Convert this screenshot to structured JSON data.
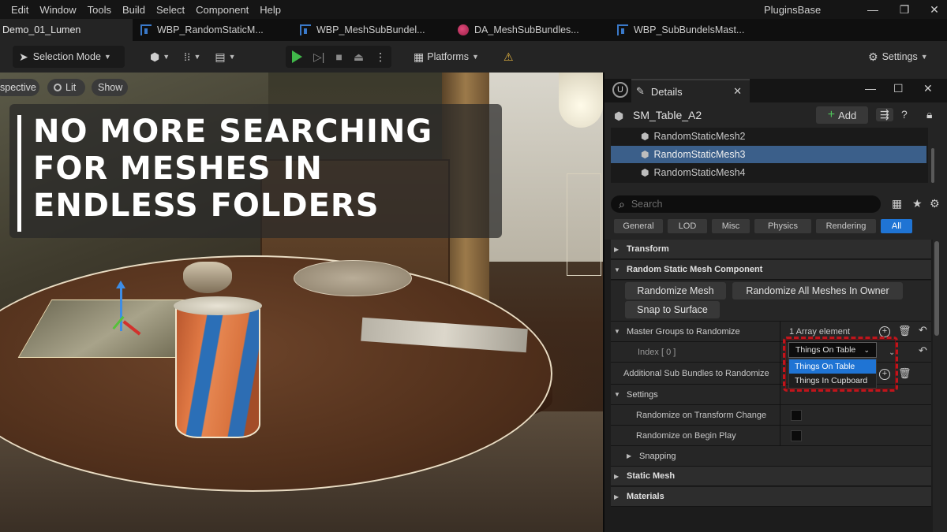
{
  "menu": [
    "Edit",
    "Window",
    "Tools",
    "Build",
    "Select",
    "Component",
    "Help"
  ],
  "project_name": "PluginsBase",
  "window_controls": {
    "minimize": "—",
    "restore": "❐",
    "close": "✕"
  },
  "tabs": [
    {
      "label": "Demo_01_Lumen",
      "icon": "level-icon"
    },
    {
      "label": "WBP_RandomStaticM...",
      "icon": "widget-blueprint-icon"
    },
    {
      "label": "WBP_MeshSubBundel...",
      "icon": "widget-blueprint-icon"
    },
    {
      "label": "DA_MeshSubBundles...",
      "icon": "data-asset-icon"
    },
    {
      "label": "WBP_SubBundelsMast...",
      "icon": "widget-blueprint-icon"
    }
  ],
  "toolbar": {
    "selection_mode": "Selection Mode",
    "platforms": "Platforms",
    "settings": "Settings"
  },
  "viewport": {
    "perspective": "spective",
    "lit": "Lit",
    "show": "Show"
  },
  "headline": [
    "NO MORE SEARCHING",
    "FOR MESHES IN",
    "ENDLESS FOLDERS"
  ],
  "details": {
    "tab_label": "Details",
    "actor_name": "SM_Table_A2",
    "add_label": "Add",
    "tree": [
      {
        "label": "RandomStaticMesh2",
        "selected": false
      },
      {
        "label": "RandomStaticMesh3",
        "selected": true
      },
      {
        "label": "RandomStaticMesh4",
        "selected": false
      }
    ],
    "search_placeholder": "Search",
    "filters": [
      {
        "label": "General",
        "active": false
      },
      {
        "label": "LOD",
        "active": false
      },
      {
        "label": "Misc",
        "active": false
      },
      {
        "label": "Physics",
        "active": false
      },
      {
        "label": "Rendering",
        "active": false
      },
      {
        "label": "All",
        "active": true
      }
    ],
    "sections": {
      "transform": "Transform",
      "component": "Random Static Mesh Component",
      "settings": "Settings",
      "snapping": "Snapping",
      "static_mesh": "Static Mesh",
      "materials": "Materials"
    },
    "buttons": {
      "randomize_mesh": "Randomize Mesh",
      "randomize_all": "Randomize All Meshes In Owner",
      "snap_to_surface": "Snap to Surface"
    },
    "master_groups": {
      "label": "Master Groups to Randomize",
      "count": "1 Array element",
      "index_label": "Index [ 0 ]",
      "selected_value": "Things On Table",
      "options": [
        "Things On Table",
        "Things In Cupboard"
      ]
    },
    "additional_sub_bundles": "Additional Sub Bundles to Randomize",
    "randomize_on_transform_change": "Randomize on Transform Change",
    "randomize_on_begin_play": "Randomize on Begin Play"
  }
}
